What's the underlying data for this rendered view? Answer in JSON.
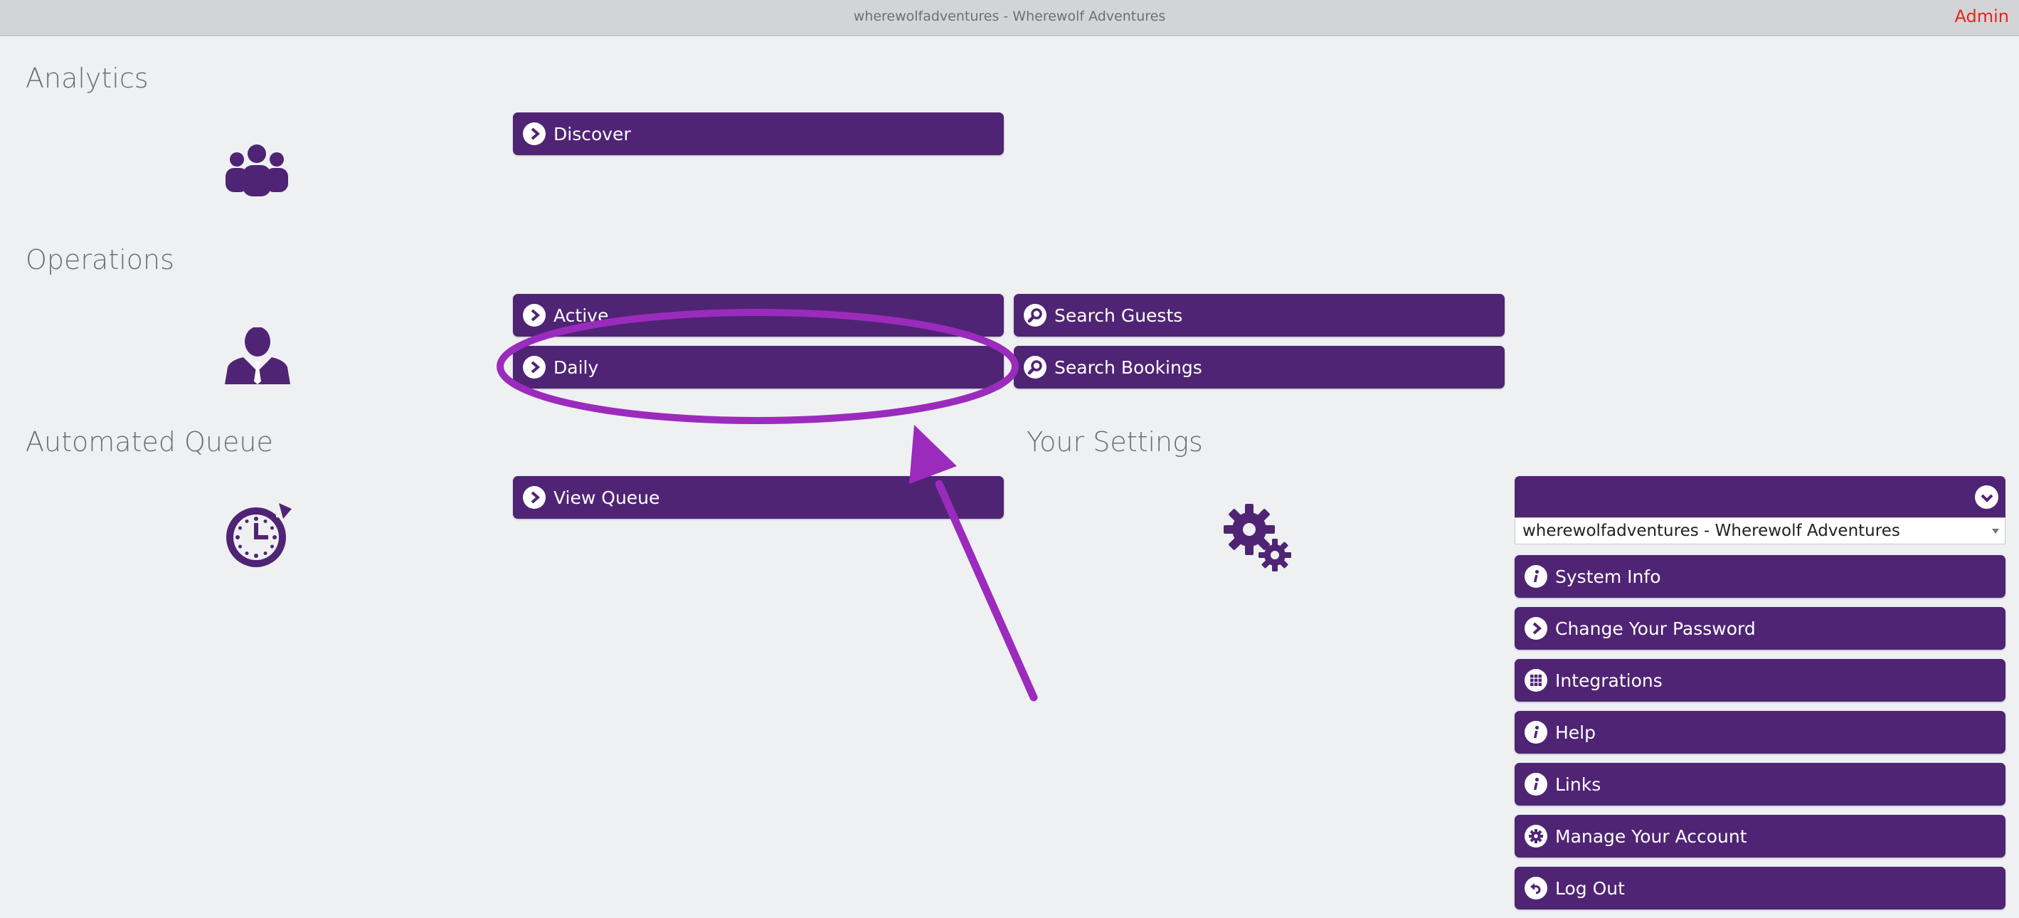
{
  "topbar": {
    "title": "wherewolfadventures - Wherewolf Adventures",
    "admin": "Admin"
  },
  "sections": {
    "analytics": {
      "title": "Analytics",
      "buttons": {
        "discover": "Discover"
      }
    },
    "operations": {
      "title": "Operations",
      "buttons": {
        "active": "Active",
        "daily": "Daily",
        "search_guests": "Search Guests",
        "search_bookings": "Search Bookings"
      }
    },
    "queue": {
      "title": "Automated Queue",
      "buttons": {
        "view_queue": "View Queue"
      }
    },
    "settings": {
      "title": "Your Settings",
      "account_select": {
        "selected": "wherewolfadventures - Wherewolf Adventures"
      },
      "menu": {
        "system_info": "System Info",
        "change_password": "Change Your Password",
        "integrations": "Integrations",
        "help": "Help",
        "links": "Links",
        "manage_account": "Manage Your Account",
        "log_out": "Log Out"
      }
    }
  },
  "colors": {
    "accent": "#4f2474",
    "admin": "#e4261c",
    "annotation": "#9b2bbd",
    "background": "#eff0f2"
  },
  "icons": {
    "analytics": "group-icon",
    "operations": "user-icon",
    "queue": "clock-refresh-icon",
    "settings": "gears-icon",
    "nav": "chevron-circle-icon",
    "search": "magnifier-icon",
    "info": "info-icon",
    "grid": "grid-icon",
    "gear": "gear-icon",
    "logout": "undo-icon",
    "dropdown": "chevron-down-icon"
  }
}
